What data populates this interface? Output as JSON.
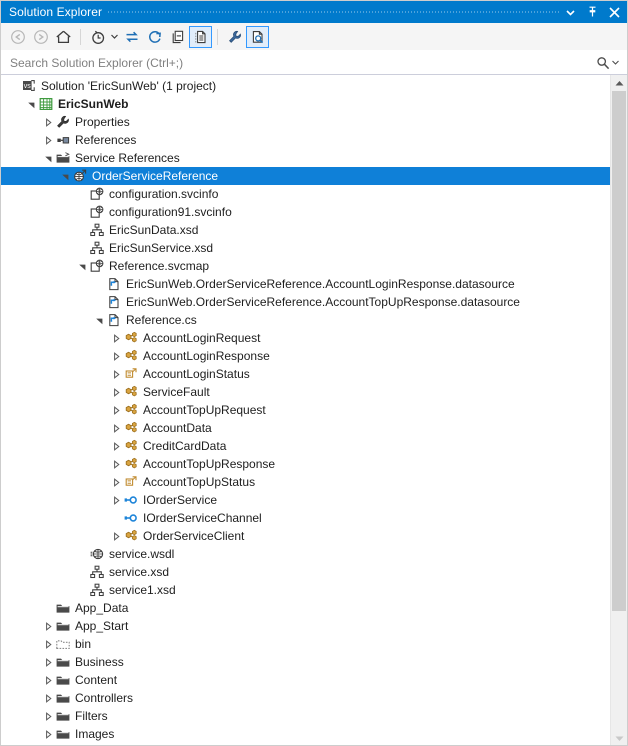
{
  "window": {
    "title": "Solution Explorer",
    "accent_color": "#007acc",
    "selection_color": "#0f80d8",
    "buttons": [
      {
        "name": "window-menu-button",
        "icon": "chevron-down-icon",
        "label": "▾"
      },
      {
        "name": "auto-hide-button",
        "icon": "pin-icon",
        "label": "⚐"
      },
      {
        "name": "close-button",
        "icon": "close-icon",
        "label": "✕"
      }
    ]
  },
  "toolbar": {
    "items": [
      {
        "name": "back-button",
        "icon": "arrow-back-icon",
        "tooltip": "Back",
        "state": "disabled"
      },
      {
        "name": "forward-button",
        "icon": "arrow-forward-icon",
        "tooltip": "Forward",
        "state": "disabled"
      },
      {
        "name": "home-button",
        "icon": "home-icon",
        "tooltip": "Home",
        "state": "normal"
      },
      {
        "name": "separator-1",
        "icon": "separator",
        "tooltip": "",
        "state": "separator"
      },
      {
        "name": "pending-changes-button",
        "icon": "clock-icon",
        "tooltip": "Pending Changes Filter",
        "state": "normal"
      },
      {
        "name": "pending-changes-dropdown",
        "icon": "caret-down-icon",
        "tooltip": "Filter options",
        "state": "caret"
      },
      {
        "name": "sync-with-active-document-button",
        "icon": "sync-arrows-icon",
        "tooltip": "Sync with Active Document",
        "state": "normal"
      },
      {
        "name": "refresh-button",
        "icon": "refresh-icon",
        "tooltip": "Refresh",
        "state": "normal"
      },
      {
        "name": "collapse-all-button",
        "icon": "collapse-all-icon",
        "tooltip": "Collapse All",
        "state": "normal"
      },
      {
        "name": "show-all-files-button",
        "icon": "show-all-files-icon",
        "tooltip": "Show All Files",
        "state": "checked"
      },
      {
        "name": "separator-2",
        "icon": "separator",
        "tooltip": "",
        "state": "separator"
      },
      {
        "name": "properties-button",
        "icon": "wrench-icon",
        "tooltip": "Properties",
        "state": "normal"
      },
      {
        "name": "preview-selected-items-button",
        "icon": "preview-file-icon",
        "tooltip": "Preview Selected Items",
        "state": "checked"
      }
    ]
  },
  "search": {
    "value": "",
    "placeholder": "Search Solution Explorer (Ctrl+;)",
    "icon": "search-icon",
    "dropdown_icon": "caret-down-icon"
  },
  "scrollbar": {
    "up_arrow": "scroll-up-icon",
    "down_arrow": "scroll-down-icon",
    "thumb": "scroll-thumb"
  },
  "tree": {
    "rows": [
      {
        "label": "Solution 'EricSunWeb' (1 project)",
        "indent": 0,
        "expander": "none",
        "icon": "solution-icon",
        "bold": false,
        "selected": false
      },
      {
        "label": "EricSunWeb",
        "indent": 1,
        "expander": "expanded",
        "icon": "web-project-icon",
        "bold": true,
        "selected": false
      },
      {
        "label": "Properties",
        "indent": 2,
        "expander": "collapsed",
        "icon": "wrench-icon",
        "bold": false,
        "selected": false
      },
      {
        "label": "References",
        "indent": 2,
        "expander": "collapsed",
        "icon": "references-icon",
        "bold": false,
        "selected": false
      },
      {
        "label": "Service References",
        "indent": 2,
        "expander": "expanded",
        "icon": "folder-open-icon",
        "bold": false,
        "selected": false
      },
      {
        "label": "OrderServiceReference",
        "indent": 3,
        "expander": "expanded",
        "icon": "service-ref-icon",
        "bold": false,
        "selected": true
      },
      {
        "label": "configuration.svcinfo",
        "indent": 4,
        "expander": "none",
        "icon": "svcinfo-icon",
        "bold": false,
        "selected": false
      },
      {
        "label": "configuration91.svcinfo",
        "indent": 4,
        "expander": "none",
        "icon": "svcinfo-icon",
        "bold": false,
        "selected": false
      },
      {
        "label": "EricSunData.xsd",
        "indent": 4,
        "expander": "none",
        "icon": "xsd-icon",
        "bold": false,
        "selected": false
      },
      {
        "label": "EricSunService.xsd",
        "indent": 4,
        "expander": "none",
        "icon": "xsd-icon",
        "bold": false,
        "selected": false
      },
      {
        "label": "Reference.svcmap",
        "indent": 4,
        "expander": "expanded",
        "icon": "svcinfo-icon",
        "bold": false,
        "selected": false
      },
      {
        "label": "EricSunWeb.OrderServiceReference.AccountLoginResponse.datasource",
        "indent": 5,
        "expander": "none",
        "icon": "datasource-icon",
        "bold": false,
        "selected": false
      },
      {
        "label": "EricSunWeb.OrderServiceReference.AccountTopUpResponse.datasource",
        "indent": 5,
        "expander": "none",
        "icon": "datasource-icon",
        "bold": false,
        "selected": false
      },
      {
        "label": "Reference.cs",
        "indent": 5,
        "expander": "expanded",
        "icon": "csharp-file-icon",
        "bold": false,
        "selected": false
      },
      {
        "label": "AccountLoginRequest",
        "indent": 6,
        "expander": "collapsed",
        "icon": "class-icon",
        "bold": false,
        "selected": false
      },
      {
        "label": "AccountLoginResponse",
        "indent": 6,
        "expander": "collapsed",
        "icon": "class-icon",
        "bold": false,
        "selected": false
      },
      {
        "label": "AccountLoginStatus",
        "indent": 6,
        "expander": "collapsed",
        "icon": "enum-icon",
        "bold": false,
        "selected": false
      },
      {
        "label": "ServiceFault",
        "indent": 6,
        "expander": "collapsed",
        "icon": "class-icon",
        "bold": false,
        "selected": false
      },
      {
        "label": "AccountTopUpRequest",
        "indent": 6,
        "expander": "collapsed",
        "icon": "class-icon",
        "bold": false,
        "selected": false
      },
      {
        "label": "AccountData",
        "indent": 6,
        "expander": "collapsed",
        "icon": "class-icon",
        "bold": false,
        "selected": false
      },
      {
        "label": "CreditCardData",
        "indent": 6,
        "expander": "collapsed",
        "icon": "class-icon",
        "bold": false,
        "selected": false
      },
      {
        "label": "AccountTopUpResponse",
        "indent": 6,
        "expander": "collapsed",
        "icon": "class-icon",
        "bold": false,
        "selected": false
      },
      {
        "label": "AccountTopUpStatus",
        "indent": 6,
        "expander": "collapsed",
        "icon": "enum-icon",
        "bold": false,
        "selected": false
      },
      {
        "label": "IOrderService",
        "indent": 6,
        "expander": "collapsed",
        "icon": "interface-icon",
        "bold": false,
        "selected": false
      },
      {
        "label": "IOrderServiceChannel",
        "indent": 6,
        "expander": "none",
        "icon": "interface-icon",
        "bold": false,
        "selected": false
      },
      {
        "label": "OrderServiceClient",
        "indent": 6,
        "expander": "collapsed",
        "icon": "class-icon",
        "bold": false,
        "selected": false
      },
      {
        "label": "service.wsdl",
        "indent": 4,
        "expander": "none",
        "icon": "wsdl-icon",
        "bold": false,
        "selected": false
      },
      {
        "label": "service.xsd",
        "indent": 4,
        "expander": "none",
        "icon": "xsd-icon",
        "bold": false,
        "selected": false
      },
      {
        "label": "service1.xsd",
        "indent": 4,
        "expander": "none",
        "icon": "xsd-icon",
        "bold": false,
        "selected": false
      },
      {
        "label": "App_Data",
        "indent": 2,
        "expander": "none",
        "icon": "folder-icon",
        "bold": false,
        "selected": false
      },
      {
        "label": "App_Start",
        "indent": 2,
        "expander": "collapsed",
        "icon": "folder-icon",
        "bold": false,
        "selected": false
      },
      {
        "label": "bin",
        "indent": 2,
        "expander": "collapsed",
        "icon": "folder-excluded-icon",
        "bold": false,
        "selected": false
      },
      {
        "label": "Business",
        "indent": 2,
        "expander": "collapsed",
        "icon": "folder-icon",
        "bold": false,
        "selected": false
      },
      {
        "label": "Content",
        "indent": 2,
        "expander": "collapsed",
        "icon": "folder-icon",
        "bold": false,
        "selected": false
      },
      {
        "label": "Controllers",
        "indent": 2,
        "expander": "collapsed",
        "icon": "folder-icon",
        "bold": false,
        "selected": false
      },
      {
        "label": "Filters",
        "indent": 2,
        "expander": "collapsed",
        "icon": "folder-icon",
        "bold": false,
        "selected": false
      },
      {
        "label": "Images",
        "indent": 2,
        "expander": "collapsed",
        "icon": "folder-icon",
        "bold": false,
        "selected": false
      }
    ]
  }
}
